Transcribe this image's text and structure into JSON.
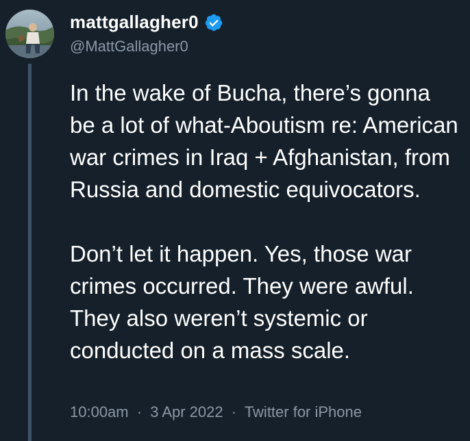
{
  "author": {
    "display_name": "mattgallagher0",
    "handle": "@MattGallagher0",
    "verified_icon": "verified-badge-icon"
  },
  "tweet": {
    "paragraphs": [
      "In the wake of Bucha, there’s gonna be a lot of what-Aboutism re: American war crimes in Iraq + Afghanistan, from Russia and domestic equivocators.",
      "Don’t let it happen. Yes, those war crimes occurred. They were awful. They also weren’t systemic or conducted on a mass scale."
    ]
  },
  "meta": {
    "time": "10:00am",
    "separator": "·",
    "date": "3 Apr 2022",
    "source": "Twitter for iPhone"
  },
  "colors": {
    "background": "#15202b",
    "text": "#ffffff",
    "secondary": "#8b98a5",
    "verified": "#1d9bf0",
    "thread_line": "#3d5466"
  }
}
